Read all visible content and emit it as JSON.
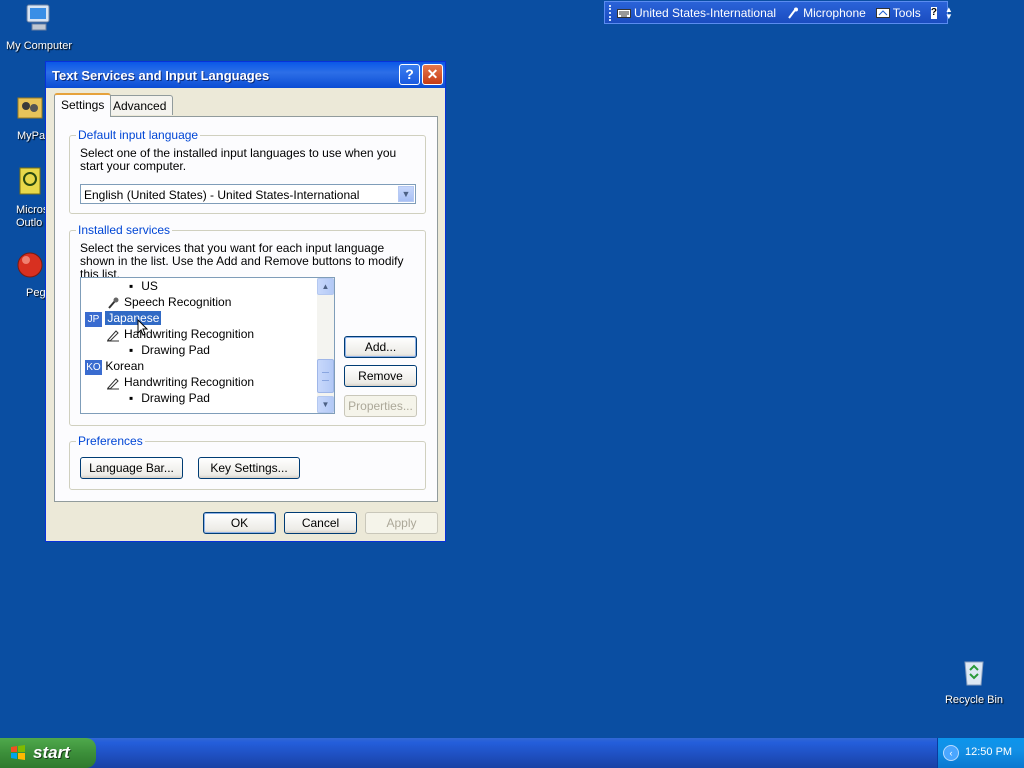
{
  "desktop": {
    "icons": [
      {
        "label": "My Computer"
      },
      {
        "label": "MyPa"
      },
      {
        "label": "Micros Outlo"
      },
      {
        "label": "Peg"
      },
      {
        "label": "Recycle Bin"
      }
    ]
  },
  "language_bar": {
    "language": "United States-International",
    "microphone": "Microphone",
    "tools": "Tools",
    "help": "?"
  },
  "dialog": {
    "title": "Text Services and Input Languages",
    "tabs": [
      {
        "label": "Settings"
      },
      {
        "label": "Advanced"
      }
    ],
    "default_input": {
      "title": "Default input language",
      "description": "Select one of the installed input languages to use when you start your computer.",
      "selected": "English (United States) - United States-International"
    },
    "installed_services": {
      "title": "Installed services",
      "description": "Select the services that you want for each input language shown in the list. Use the Add and Remove buttons to modify this list.",
      "tree": [
        {
          "text": "US"
        },
        {
          "text": "Speech Recognition"
        },
        {
          "code": "JP",
          "text": "Japanese"
        },
        {
          "text": "Handwriting Recognition"
        },
        {
          "text": "Drawing Pad"
        },
        {
          "code": "KO",
          "text": "Korean"
        },
        {
          "text": "Handwriting Recognition"
        },
        {
          "text": "Drawing Pad"
        }
      ],
      "add_button": "Add...",
      "remove_button": "Remove",
      "properties_button": "Properties..."
    },
    "preferences": {
      "title": "Preferences",
      "language_bar_button": "Language Bar...",
      "key_settings_button": "Key Settings..."
    },
    "ok_button": "OK",
    "cancel_button": "Cancel",
    "apply_button": "Apply"
  },
  "taskbar": {
    "start_label": "start",
    "clock": "12:50 PM"
  }
}
